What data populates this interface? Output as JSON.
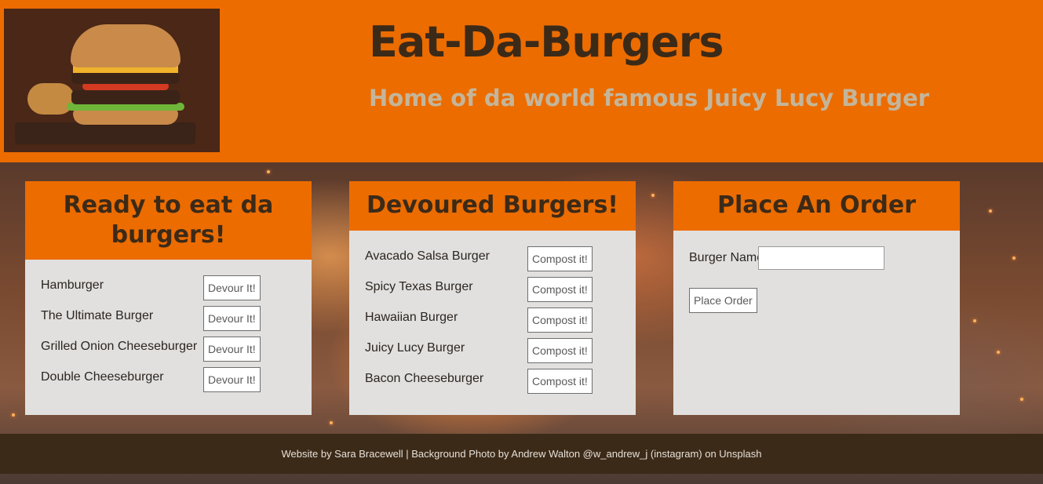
{
  "header": {
    "title": "Eat-Da-Burgers",
    "subtitle": "Home of da world famous Juicy Lucy Burger",
    "logo": "burger-photo"
  },
  "colors": {
    "primary": "#ec6c00",
    "dark": "#3c2a18",
    "card": "#e1e0df",
    "subtitle": "#c4b59a"
  },
  "ready": {
    "title": "Ready to eat da burgers!",
    "button_label": "Devour It!",
    "items": [
      {
        "name": "Hamburger"
      },
      {
        "name": "The Ultimate Burger"
      },
      {
        "name": "Grilled Onion Cheeseburger"
      },
      {
        "name": "Double Cheeseburger"
      }
    ]
  },
  "devoured": {
    "title": "Devoured Burgers!",
    "button_label": "Compost it!",
    "items": [
      {
        "name": "Avacado Salsa Burger"
      },
      {
        "name": "Spicy Texas Burger"
      },
      {
        "name": "Hawaiian Burger"
      },
      {
        "name": "Juicy Lucy Burger"
      },
      {
        "name": "Bacon Cheeseburger"
      }
    ]
  },
  "order": {
    "title": "Place An Order",
    "label": "Burger Name:",
    "input_value": "",
    "button_label": "Place Order"
  },
  "footer": {
    "text": "Website by Sara Bracewell | Background Photo by Andrew Walton @w_andrew_j (instagram) on Unsplash"
  }
}
